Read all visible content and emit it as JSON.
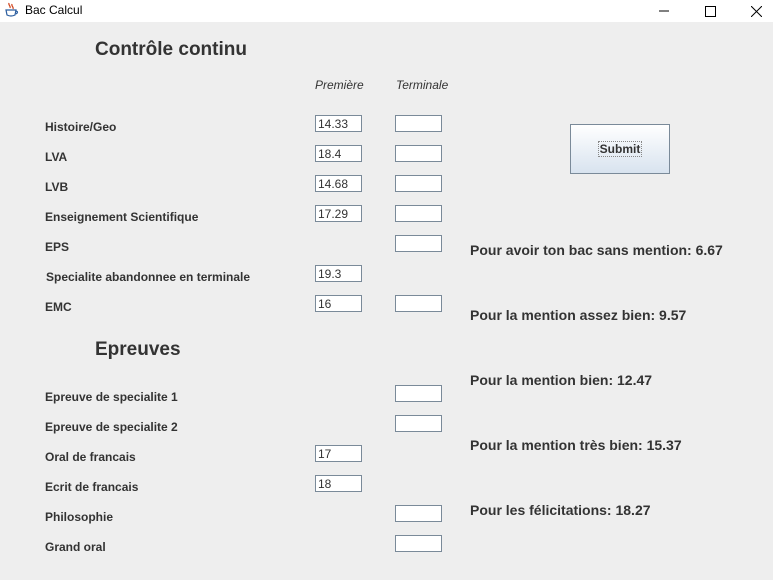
{
  "window": {
    "title": "Bac Calcul",
    "icon": "java-cup-icon",
    "controls": [
      "minimize-icon",
      "maximize-icon",
      "close-icon"
    ]
  },
  "sections": {
    "controle_continu": "Contrôle continu",
    "epreuves": "Epreuves"
  },
  "columns": {
    "premiere": "Première",
    "terminale": "Terminale"
  },
  "controle_rows": [
    {
      "label": "Histoire/Geo",
      "premiere": "14.33",
      "terminale": ""
    },
    {
      "label": "LVA",
      "premiere": "18.4",
      "terminale": ""
    },
    {
      "label": "LVB",
      "premiere": "14.68",
      "terminale": ""
    },
    {
      "label": "Enseignement Scientifique",
      "premiere": "17.29",
      "terminale": ""
    },
    {
      "label": "EPS",
      "terminale": ""
    },
    {
      "label": "Specialite abandonnee en terminale",
      "premiere": "19.3"
    },
    {
      "label": "EMC",
      "premiere": "16",
      "terminale": ""
    }
  ],
  "epreuves_rows": [
    {
      "label": "Epreuve de specialite 1",
      "terminale": ""
    },
    {
      "label": "Epreuve de specialite 2",
      "terminale": ""
    },
    {
      "label": "Oral de francais",
      "premiere": "17"
    },
    {
      "label": "Ecrit de francais",
      "premiere": "18"
    },
    {
      "label": "Philosophie",
      "terminale": ""
    },
    {
      "label": "Grand oral",
      "terminale": ""
    }
  ],
  "submit_label": "Submit",
  "results": [
    "Pour avoir ton bac sans mention: 6.67",
    "Pour la mention assez bien: 9.57",
    "Pour la mention bien: 12.47",
    "Pour la mention très bien: 15.37",
    "Pour les félicitations: 18.27"
  ]
}
